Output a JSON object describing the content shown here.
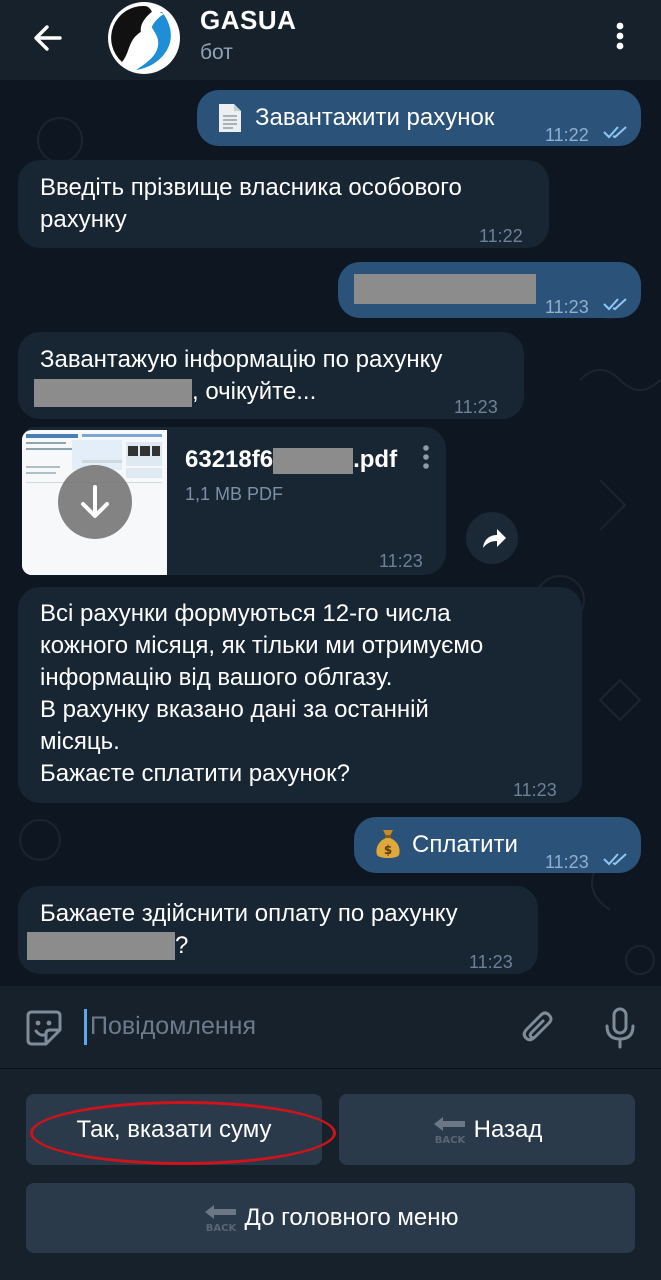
{
  "header": {
    "title": "GASUA",
    "subtitle": "бот",
    "back_icon": "arrow-left-icon",
    "menu_icon": "more-vertical-icon"
  },
  "messages": [
    {
      "direction": "out",
      "icon": "document-icon",
      "text": "Завантажити рахунок",
      "time": "11:22",
      "read": true
    },
    {
      "direction": "in",
      "lines": [
        "Введіть прізвище власника особового",
        "рахунку"
      ],
      "time": "11:22"
    },
    {
      "direction": "out",
      "text": "",
      "redacted": true,
      "time": "11:23",
      "read": true
    },
    {
      "direction": "in",
      "lines": [
        "Завантажую інформацію по рахунку",
        ", очікуйте..."
      ],
      "redacted_line_2_prefix": true,
      "time": "11:23"
    },
    {
      "direction": "in",
      "type": "file",
      "file_name_prefix": "63218f6",
      "file_name_suffix": ".pdf",
      "file_size": "1,1 MB PDF",
      "time": "11:23"
    },
    {
      "direction": "in",
      "lines": [
        "Всі рахунки формуються 12-го числа",
        "кожного місяця, як тільки ми отримуємо",
        "інформацію від вашого облгазу.",
        "В рахунку вказано дані за останній",
        "місяць.",
        "Бажаєте сплатити рахунок?"
      ],
      "time": "11:23"
    },
    {
      "direction": "out",
      "icon": "money-bag-icon",
      "text": "Сплатити",
      "time": "11:23",
      "read": true
    },
    {
      "direction": "in",
      "lines": [
        "Бажаете здійснити оплату по рахунку",
        "?"
      ],
      "redacted_line_2_prefix": true,
      "time": "11:23"
    }
  ],
  "input": {
    "placeholder": "Повідомлення",
    "value": ""
  },
  "keyboard": {
    "buttons": [
      {
        "label": "Так, вказати суму",
        "highlighted": true
      },
      {
        "label": "Назад",
        "icon": "back-arrow-icon"
      },
      {
        "label": "До головного меню",
        "icon": "back-arrow-icon"
      }
    ],
    "back_icon_text": "BACK"
  },
  "colors": {
    "background": "#0e1621",
    "header": "#17212b",
    "incoming_bubble": "#182533",
    "outgoing_bubble": "#2b5278",
    "keyboard_button": "#2b3a4a",
    "highlight": "#d0121b",
    "accent": "#5fa8e8"
  }
}
